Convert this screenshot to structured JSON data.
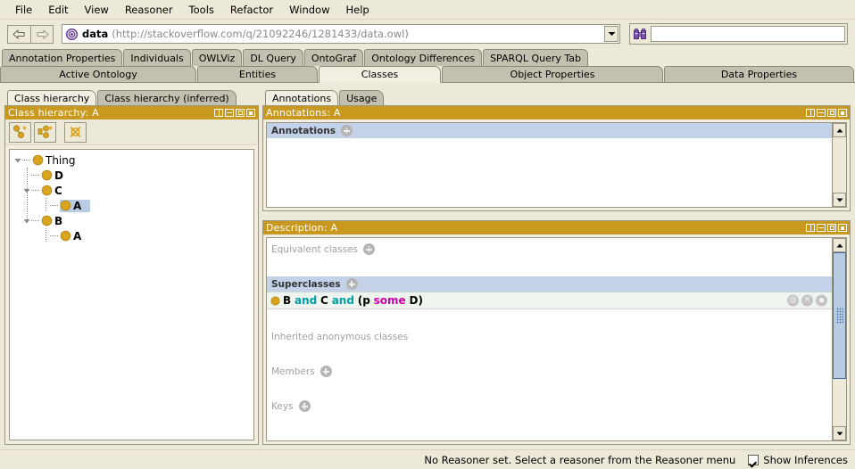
{
  "menu": {
    "items": [
      "File",
      "Edit",
      "View",
      "Reasoner",
      "Tools",
      "Refactor",
      "Window",
      "Help"
    ]
  },
  "toolbar": {
    "back_icon": "back-arrow-icon",
    "forward_icon": "forward-arrow-icon",
    "ontology_icon": "ontology-icon",
    "ontology_name": "data",
    "ontology_iri": "(http://stackoverflow.com/q/21092246/1281433/data.owl)",
    "dropdown_icon": "chevron-down-icon",
    "search_icon": "binoculars-icon",
    "search_value": "",
    "search_placeholder": ""
  },
  "tabs_row1": [
    {
      "label": "Annotation Properties"
    },
    {
      "label": "Individuals"
    },
    {
      "label": "OWLViz"
    },
    {
      "label": "DL Query"
    },
    {
      "label": "OntoGraf"
    },
    {
      "label": "Ontology Differences"
    },
    {
      "label": "SPARQL Query Tab"
    }
  ],
  "tabs_row2": [
    {
      "label": "Active Ontology",
      "active": false
    },
    {
      "label": "Entities",
      "active": false
    },
    {
      "label": "Classes",
      "active": true
    },
    {
      "label": "Object Properties",
      "active": false
    },
    {
      "label": "Data Properties",
      "active": false
    }
  ],
  "left_panel": {
    "subtabs": [
      {
        "label": "Class hierarchy",
        "active": true
      },
      {
        "label": "Class hierarchy (inferred)",
        "active": false
      }
    ],
    "title": "Class hierarchy: A",
    "window_buttons": [
      "split-pane-icon",
      "minimize-icon",
      "maximize-icon",
      "close-icon"
    ],
    "toolbar_buttons": [
      {
        "name": "add-subclass-button",
        "icon": "add-subclass-icon"
      },
      {
        "name": "add-sibling-class-button",
        "icon": "add-sibling-icon"
      },
      {
        "name": "delete-class-button",
        "icon": "delete-class-icon"
      }
    ],
    "tree": [
      {
        "label": "Thing",
        "depth": 0,
        "expanded": true,
        "selected": false
      },
      {
        "label": "D",
        "depth": 1,
        "expanded": null,
        "selected": false
      },
      {
        "label": "C",
        "depth": 1,
        "expanded": true,
        "selected": false
      },
      {
        "label": "A",
        "depth": 2,
        "expanded": null,
        "selected": true
      },
      {
        "label": "B",
        "depth": 1,
        "expanded": true,
        "selected": false
      },
      {
        "label": "A",
        "depth": 2,
        "expanded": null,
        "selected": false
      }
    ]
  },
  "right_panel": {
    "subtabs": [
      {
        "label": "Annotations",
        "active": true
      },
      {
        "label": "Usage",
        "active": false
      }
    ],
    "annotations": {
      "title": "Annotations: A",
      "window_buttons": [
        "split-pane-icon",
        "minimize-icon",
        "maximize-icon",
        "close-icon"
      ],
      "section_label": "Annotations",
      "add_icon": "plus-icon"
    },
    "description": {
      "title": "Description: A",
      "window_buttons": [
        "split-pane-icon",
        "minimize-icon",
        "maximize-icon",
        "close-icon"
      ],
      "sections": {
        "equivalent_classes": "Equivalent classes",
        "superclasses": "Superclasses",
        "inherited_anonymous": "Inherited anonymous classes",
        "members": "Members",
        "keys": "Keys"
      },
      "superclass_expression": {
        "tokens": [
          {
            "text": "B",
            "kind": "class"
          },
          {
            "text": "and",
            "kind": "keyword-and"
          },
          {
            "text": "C",
            "kind": "class"
          },
          {
            "text": "and",
            "kind": "keyword-and"
          },
          {
            "text": "(p",
            "kind": "property-open"
          },
          {
            "text": "some",
            "kind": "keyword-some"
          },
          {
            "text": "D)",
            "kind": "class-close"
          }
        ],
        "plain": "B and C and (p some D)",
        "actions": [
          {
            "name": "annotate-axiom-button",
            "glyph": "@"
          },
          {
            "name": "delete-axiom-button",
            "glyph": "✕"
          },
          {
            "name": "edit-axiom-button",
            "glyph": "●"
          }
        ]
      }
    }
  },
  "statusbar": {
    "message": "No Reasoner set. Select a reasoner from the Reasoner menu",
    "checkbox_label": "Show Inferences",
    "checkbox_checked": true
  },
  "colors": {
    "panel_title_gold": "#c9981f",
    "section_header_blue": "#c3d2e8",
    "selection_blue": "#b8cce4",
    "expression_bg": "#eef5ee",
    "keyword_and": "#00a0a8",
    "keyword_some": "#cc00aa",
    "class_ball_gold": "#d9a521",
    "window_bg": "#ece9d8"
  }
}
